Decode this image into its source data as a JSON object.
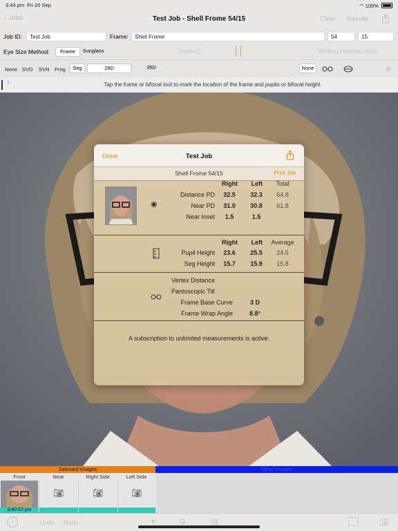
{
  "status": {
    "time": "3:43 pm",
    "date": "Fri 20 Sep",
    "battery": "100%"
  },
  "nav": {
    "back": "Jobs",
    "title": "Test Job - Shell Frome 54/15",
    "clear": "Clear",
    "results": "Results"
  },
  "job": {
    "id_label": "Job ID:",
    "id_value": "Test Job",
    "frame_label": "Frame:",
    "frame_value": "Shell Frome",
    "size_a": "54",
    "size_b": "15"
  },
  "eye": {
    "label": "Eye Size Method:",
    "options": [
      "Frame",
      "Sunglass"
    ],
    "selected": "Frame",
    "frame_center_hint": "Frame C",
    "working_distance": "Working Distance: 45cm"
  },
  "lens": {
    "types": [
      "None",
      "SVD",
      "SVN",
      "Prog",
      "Seg"
    ],
    "selected": "Seg",
    "seg_sizes": [
      "28D",
      "35D"
    ],
    "selected_seg": "28D",
    "frame_option": "None"
  },
  "info": {
    "mark": "?",
    "text": "Tap the frame or bifocal tool to mark the location of the frame and pupils or bifocal height."
  },
  "modal": {
    "done": "Done",
    "title": "Test Job",
    "subtitle": "Shell Frome 54/15",
    "print": "Print Job",
    "pd": {
      "headers": [
        "Right",
        "Left",
        "Total"
      ],
      "rows": [
        {
          "label": "Distance PD",
          "right": "32.5",
          "left": "32.3",
          "total": "64.8"
        },
        {
          "label": "Near PD",
          "right": "31.0",
          "left": "30.8",
          "total": "61.8"
        },
        {
          "label": "Near Inset",
          "right": "1.5",
          "left": "1.5",
          "total": ""
        }
      ]
    },
    "height": {
      "headers": [
        "Right",
        "Left",
        "Average"
      ],
      "rows": [
        {
          "label": "Pupil Height",
          "right": "23.6",
          "left": "25.5",
          "avg": "24.5"
        },
        {
          "label": "Seg Height",
          "right": "15.7",
          "left": "15.9",
          "avg": "15.8"
        }
      ]
    },
    "frame": {
      "rows": [
        {
          "label": "Vertex Distance",
          "value": ""
        },
        {
          "label": "Pantoscopic Tilt",
          "value": ""
        },
        {
          "label": "Frame Base Curve",
          "value": "3 D"
        },
        {
          "label": "Frame Wrap Angle",
          "value": "8.8°"
        }
      ]
    },
    "subscription": "A subscription to unlimited measurements is active."
  },
  "images": {
    "selected_label": "Selected Images",
    "other_label": "Other Images",
    "slots": [
      "Front",
      "Near",
      "Right Side",
      "Left Side"
    ],
    "front_time": "3:40:52 pm"
  },
  "toolbar": {
    "undo": "Undo",
    "redo": "Redo"
  },
  "colors": {
    "accent": "#e58e12",
    "orange_bar": "#e4801d",
    "blue_bar": "#0b1fe5",
    "teal": "#35c9b6"
  }
}
